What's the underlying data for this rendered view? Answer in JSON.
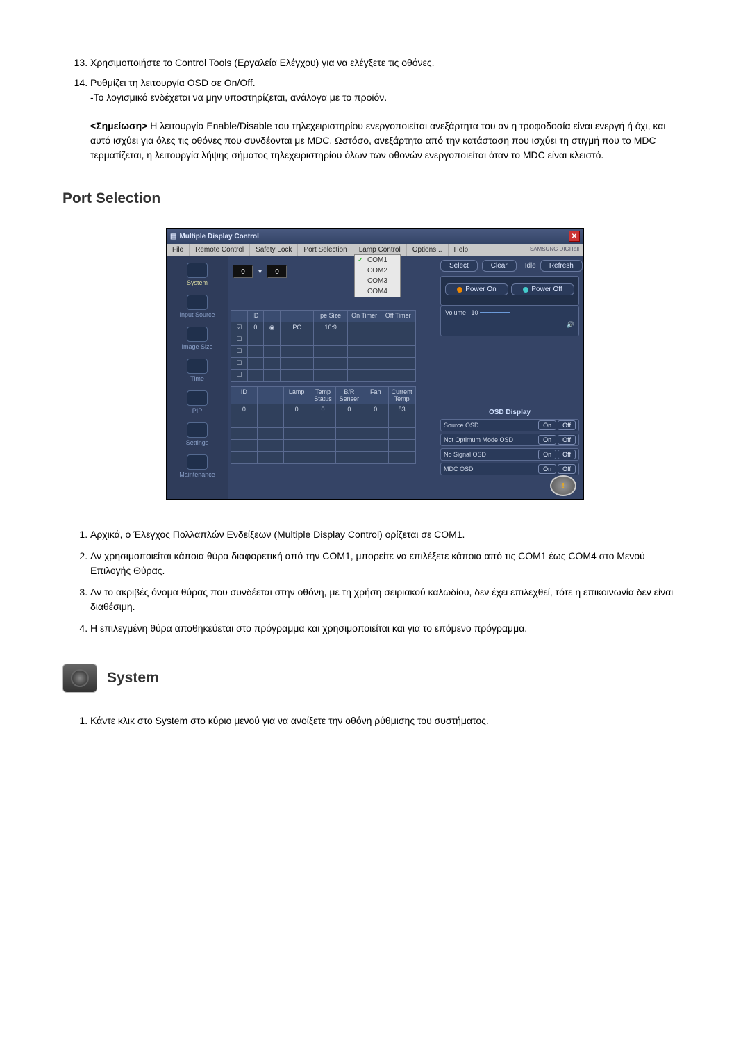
{
  "list_top": {
    "start": 13,
    "items": [
      "Χρησιμοποιήστε το Control Tools (Εργαλεία Ελέγχου) για να ελέγξετε τις οθόνες.",
      "Ρυθμίζει τη λειτουργία OSD σε On/Off."
    ],
    "item14_sub": "-Το λογισμικό ενδέχεται να μην υποστηρίζεται, ανάλογα με το προϊόν."
  },
  "note": {
    "label": "<Σημείωση>",
    "text": "Η λειτουργία Enable/Disable του τηλεχειριστηρίου ενεργοποιείται ανεξάρτητα του αν η τροφοδοσία είναι ενεργή ή όχι, και αυτό ισχύει για όλες τις οθόνες που συνδέονται με MDC. Ωστόσο, ανεξάρτητα από την κατάσταση που ισχύει τη στιγμή που το MDC τερματίζεται, η λειτουργία λήψης σήματος τηλεχειριστηρίου όλων των οθονών ενεργοποιείται όταν το MDC είναι κλειστό."
  },
  "section_port": "Port Selection",
  "mdc": {
    "title": "Multiple Display Control",
    "close": "✕",
    "menu": [
      "File",
      "Remote Control",
      "Safety Lock",
      "Port Selection",
      "Lamp Control",
      "Options...",
      "Help"
    ],
    "brand": "SAMSUNG DIGITall",
    "port_items": [
      "COM1",
      "COM2",
      "COM3",
      "COM4"
    ],
    "num1": "0",
    "num2": "0",
    "btn_select": "Select",
    "btn_clear": "Clear",
    "idle": "Idle",
    "btn_refresh": "Refresh",
    "btn_power_on": "Power On",
    "btn_power_off": "Power Off",
    "volume_label": "Volume",
    "volume_value": "10",
    "sidebar": [
      "System",
      "Input Source",
      "Image Size",
      "Time",
      "PIP",
      "Settings",
      "Maintenance"
    ],
    "table1_head": [
      "",
      "ID",
      "",
      "",
      "pe Size",
      "On Timer",
      "Off Timer"
    ],
    "table1_row": [
      "",
      "0",
      "",
      "PC",
      "16:9",
      "",
      ""
    ],
    "table2_head": [
      "ID",
      "",
      "Lamp",
      "Temp Status",
      "B/R Senser",
      "Fan",
      "Current Temp"
    ],
    "table2_row": [
      "0",
      "",
      "0",
      "0",
      "0",
      "0",
      "83"
    ],
    "osd_title": "OSD Display",
    "osd_rows": [
      "Source OSD",
      "Not Optimum Mode OSD",
      "No Signal OSD",
      "MDC OSD"
    ],
    "osd_on": "On",
    "osd_off": "Off"
  },
  "list_after": [
    "Αρχικά, ο Έλεγχος Πολλαπλών Ενδείξεων (Multiple Display Control) ορίζεται σε COM1.",
    "Αν χρησιμοποιείται κάποια θύρα διαφορετική από την COM1, μπορείτε να επιλέξετε κάποια από τις COM1 έως COM4 στο Μενού Επιλογής Θύρας.",
    "Αν το ακριβές όνομα θύρας που συνδέεται στην οθόνη, με τη χρήση σειριακού καλωδίου, δεν έχει επιλεχθεί, τότε η επικοινωνία δεν είναι διαθέσιμη.",
    "Η επιλεγμένη θύρα αποθηκεύεται στο πρόγραμμα και χρησιμοποιείται και για το επόμενο πρόγραμμα."
  ],
  "section_system": "System",
  "list_system": [
    "Κάντε κλικ στο System στο κύριο μενού για να ανοίξετε την οθόνη ρύθμισης του συστήματος."
  ]
}
